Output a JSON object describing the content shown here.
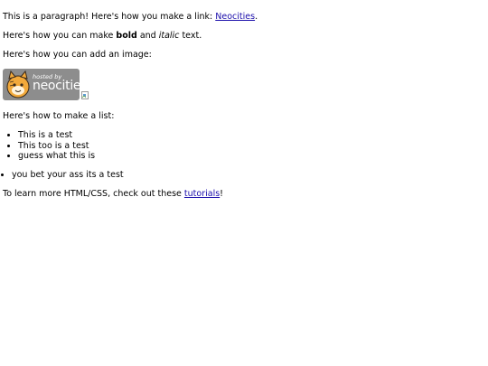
{
  "paragraph1": {
    "prefix": "This is a paragraph! Here's how you make a link: ",
    "link_label": "Neocities",
    "suffix": "."
  },
  "paragraph2": {
    "prefix": "Here's how you can make ",
    "bold": "bold",
    "middle": " and ",
    "italic": "italic",
    "suffix": " text."
  },
  "paragraph3": {
    "text": "Here's how you can add an image:"
  },
  "badge": {
    "small_text": "hosted by",
    "big_text": "neocities"
  },
  "paragraph4": {
    "text": "Here's how to make a list:"
  },
  "list1": {
    "items": [
      "This is a test",
      "This too is a test",
      "guess what this is"
    ]
  },
  "list2": {
    "items": [
      "you bet your ass its a test"
    ]
  },
  "paragraph5": {
    "prefix": "To learn more HTML/CSS, check out these ",
    "link_label": "tutorials",
    "suffix": "!"
  },
  "colors": {
    "link": "#1a0dab",
    "badge_bg": "#8d8d8d",
    "text": "#000000"
  }
}
